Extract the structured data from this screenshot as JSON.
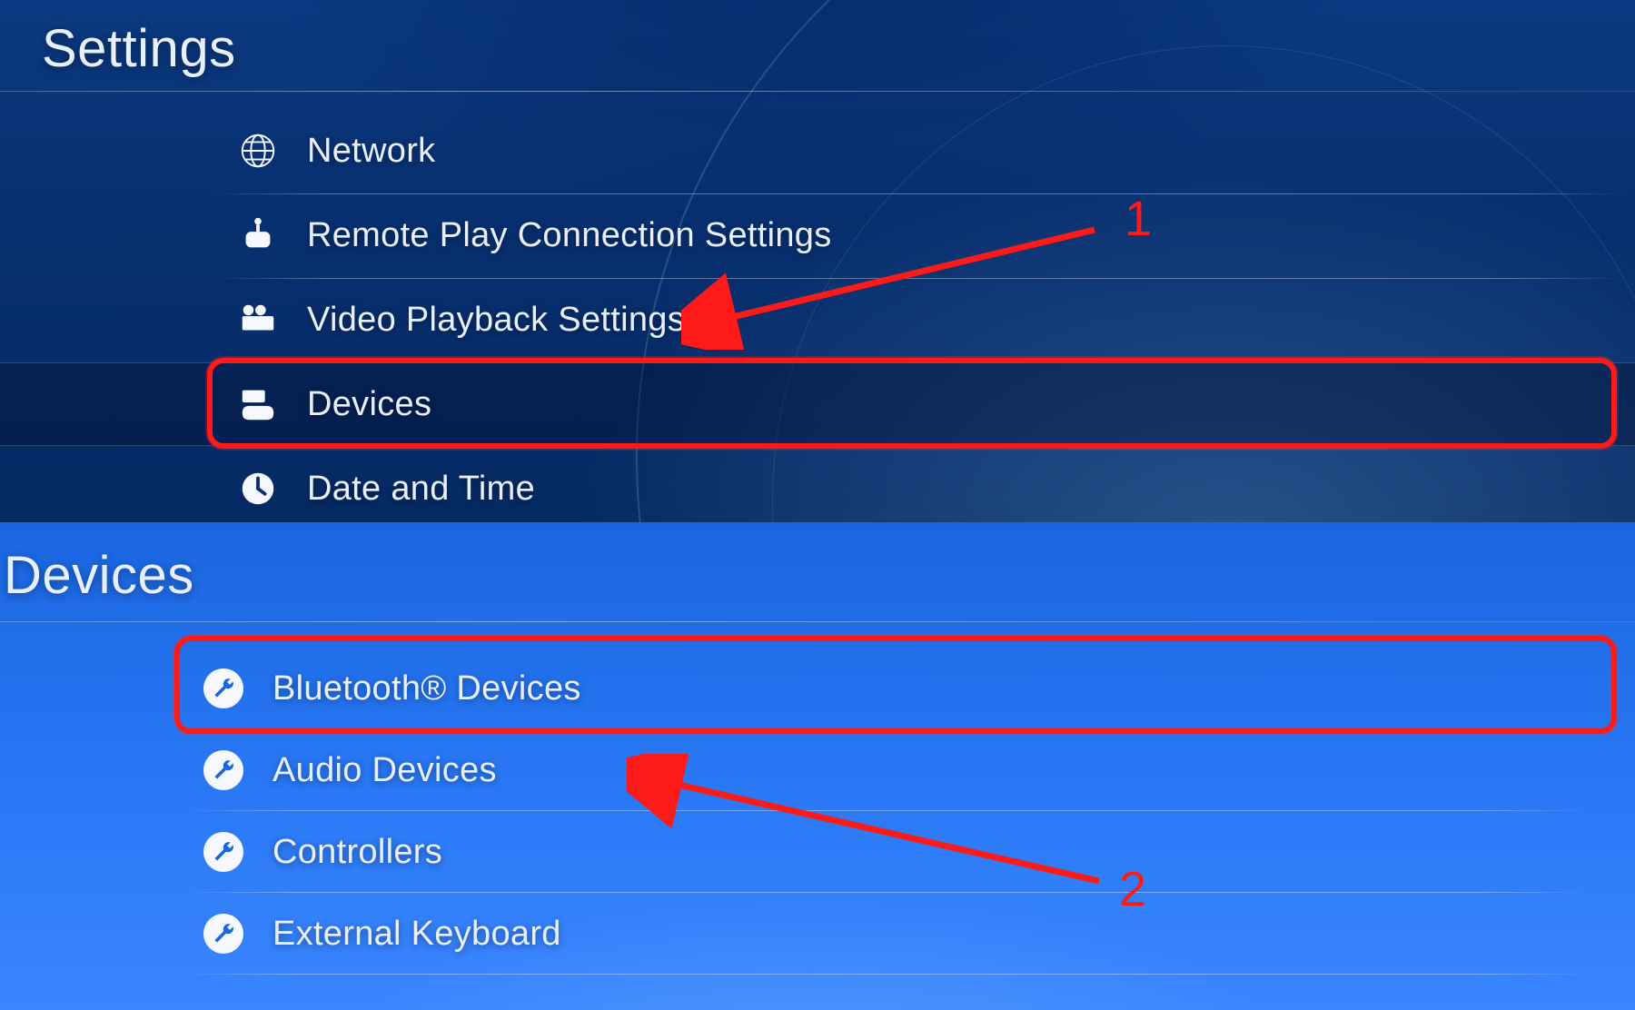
{
  "top_panel": {
    "title": "Settings",
    "items": [
      {
        "label": "Network",
        "icon": "globe-icon"
      },
      {
        "label": "Remote Play Connection Settings",
        "icon": "remote-play-icon"
      },
      {
        "label": "Video Playback Settings",
        "icon": "film-icon"
      },
      {
        "label": "Devices",
        "icon": "devices-icon"
      },
      {
        "label": "Date and Time",
        "icon": "clock-icon"
      }
    ],
    "selected_index": 3
  },
  "bottom_panel": {
    "title": "Devices",
    "items": [
      {
        "label": "Bluetooth® Devices",
        "icon": "wrench-icon"
      },
      {
        "label": "Audio Devices",
        "icon": "wrench-icon"
      },
      {
        "label": "Controllers",
        "icon": "wrench-icon"
      },
      {
        "label": "External Keyboard",
        "icon": "wrench-icon"
      }
    ],
    "selected_index": 0
  },
  "annotations": {
    "step1": "1",
    "step2": "2"
  }
}
